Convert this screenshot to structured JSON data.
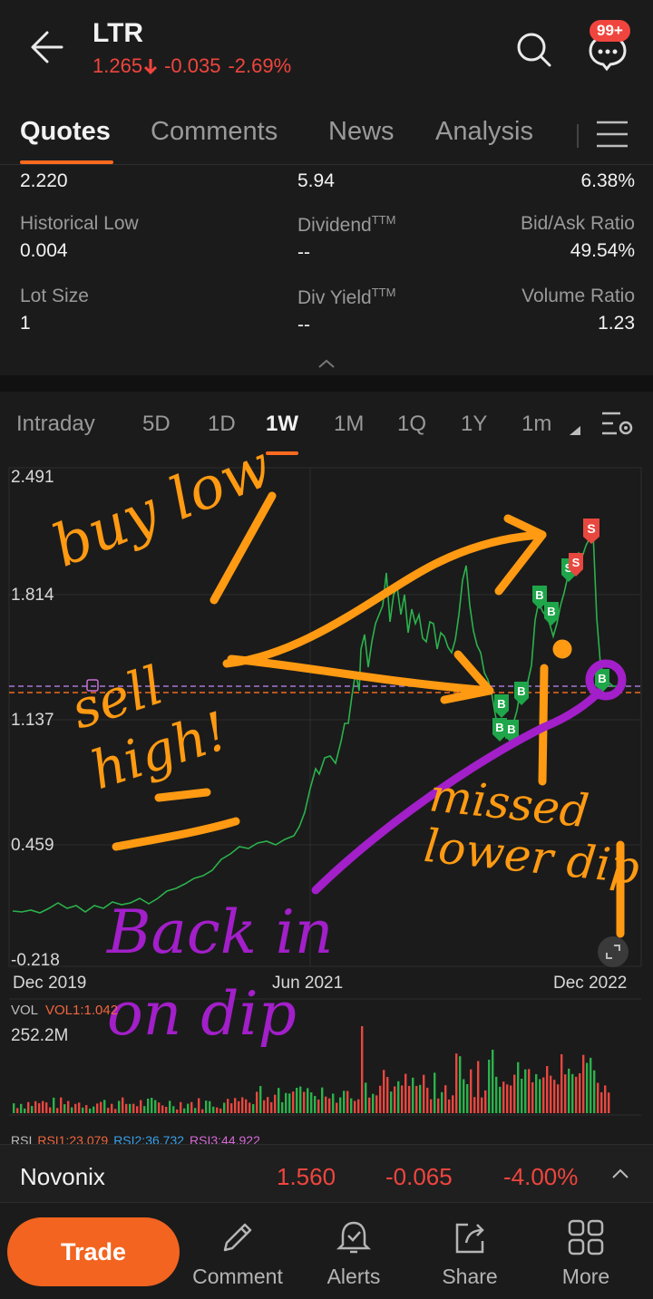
{
  "header": {
    "ticker": "LTR",
    "price": "1.265",
    "change": "-0.035",
    "change_pct": "-2.69%",
    "notif_badge": "99+"
  },
  "tabs": [
    {
      "label": "Quotes",
      "active": true
    },
    {
      "label": "Comments",
      "active": false
    },
    {
      "label": "News",
      "active": false
    },
    {
      "label": "Analysis",
      "active": false
    }
  ],
  "stats": {
    "row0": {
      "c1": "2.220",
      "c2": "5.94",
      "c3": "6.38%"
    },
    "row1": {
      "l1": "Historical Low",
      "v1": "0.004",
      "l2": "DividendTTM",
      "v2": "--",
      "l3": "Bid/Ask Ratio",
      "v3": "49.54%"
    },
    "row2": {
      "l1": "Lot Size",
      "v1": "1",
      "l2": "Div YieldTTM",
      "v2": "--",
      "l3": "Volume Ratio",
      "v3": "1.23"
    }
  },
  "periods": [
    "Intraday",
    "5D",
    "1D",
    "1W",
    "1M",
    "1Q",
    "1Y",
    "1m"
  ],
  "active_period": "1W",
  "chart": {
    "y_ticks": [
      "2.491",
      "1.814",
      "1.137",
      "0.459",
      "-0.218"
    ],
    "x_ticks": [
      "Dec 2019",
      "Jun 2021",
      "Dec 2022"
    ],
    "vol_label": "VOL",
    "vol1": "VOL1:1.042",
    "vol_max": "252.2M",
    "rsi": {
      "label": "RSI",
      "rsi1": "RSI1:23.079",
      "rsi2": "RSI2:36.732",
      "rsi3": "RSI3:44.922"
    },
    "buy_marker": "B",
    "sell_marker": "S",
    "colors": {
      "line": "#2bb24c",
      "up": "#2bb24c",
      "down": "#e8473f",
      "annot_orange": "#ff9a12",
      "annot_purple": "#a21fc9"
    },
    "annotations": [
      "buy low",
      "sell high!",
      "missed lower dip",
      "Back in on dip"
    ]
  },
  "stock_bar": {
    "name": "Novonix",
    "price": "1.560",
    "change": "-0.065",
    "change_pct": "-4.00%"
  },
  "bottom_nav": {
    "trade": "Trade",
    "comment": "Comment",
    "alerts": "Alerts",
    "share": "Share",
    "more": "More"
  }
}
